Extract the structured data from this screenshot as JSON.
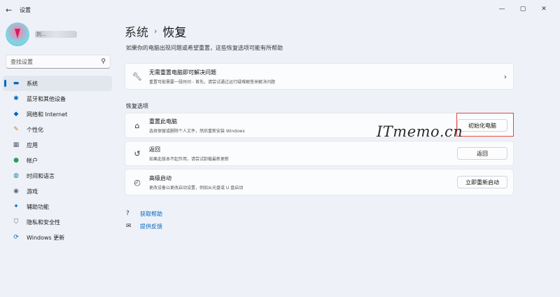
{
  "window": {
    "back_glyph": "←",
    "title": "设置",
    "controls": [
      "—",
      "▢",
      "✕"
    ]
  },
  "user": {
    "name": "刘..."
  },
  "search": {
    "placeholder": "查找设置",
    "icon": "search-icon"
  },
  "sidebar": {
    "items": [
      {
        "label": "系统",
        "icon": "monitor-icon",
        "glyph": "▬",
        "active": true
      },
      {
        "label": "蓝牙和其他设备",
        "icon": "bluetooth-icon",
        "glyph": "✱"
      },
      {
        "label": "网络和 Internet",
        "icon": "wifi-icon",
        "glyph": "◆"
      },
      {
        "label": "个性化",
        "icon": "brush-icon",
        "glyph": "✎"
      },
      {
        "label": "应用",
        "icon": "apps-icon",
        "glyph": "▦"
      },
      {
        "label": "帐户",
        "icon": "person-icon",
        "glyph": "●"
      },
      {
        "label": "时间和语言",
        "icon": "globe-clock-icon",
        "glyph": "◍"
      },
      {
        "label": "游戏",
        "icon": "gamepad-icon",
        "glyph": "◉"
      },
      {
        "label": "辅助功能",
        "icon": "accessibility-icon",
        "glyph": "✦"
      },
      {
        "label": "隐私和安全性",
        "icon": "shield-icon",
        "glyph": "⛉"
      },
      {
        "label": "Windows 更新",
        "icon": "update-icon",
        "glyph": "⟳"
      }
    ]
  },
  "breadcrumb": {
    "parent": "系统",
    "separator": "›",
    "current": "恢复"
  },
  "subtitle": "如果你的电脑出现问题或希望重置，这些恢复选项可能有所帮助",
  "fix_card": {
    "title": "无需重置电脑即可解决问题",
    "desc": "重置可能需要一段时间 - 首先，请尝试通过运行疑难解答来解决问题",
    "chevron": "›"
  },
  "section_label": "恢复选项",
  "recovery_options": [
    {
      "title": "重置此电脑",
      "desc": "选择保留或删除个人文件，然后重新安装 Windows",
      "button": "初始化电脑",
      "icon": "reset-pc-icon",
      "glyph": "⌂"
    },
    {
      "title": "返回",
      "desc": "如果此版本不起作用，请尝试卸载最新更新",
      "button": "返回",
      "icon": "history-icon",
      "glyph": "↺"
    },
    {
      "title": "高级启动",
      "desc": "更改设备以更改启动设置，例如从光盘或 U 盘启动",
      "button": "立即重新启动",
      "icon": "advanced-startup-icon",
      "glyph": "◴"
    }
  ],
  "links": [
    {
      "label": "获取帮助",
      "icon": "help-icon",
      "glyph": "?"
    },
    {
      "label": "提供反馈",
      "icon": "feedback-icon",
      "glyph": "✉"
    }
  ],
  "watermark": "ITmemo.cn",
  "colors": {
    "accent": "#0067c0",
    "highlight_box": "#e04848"
  }
}
